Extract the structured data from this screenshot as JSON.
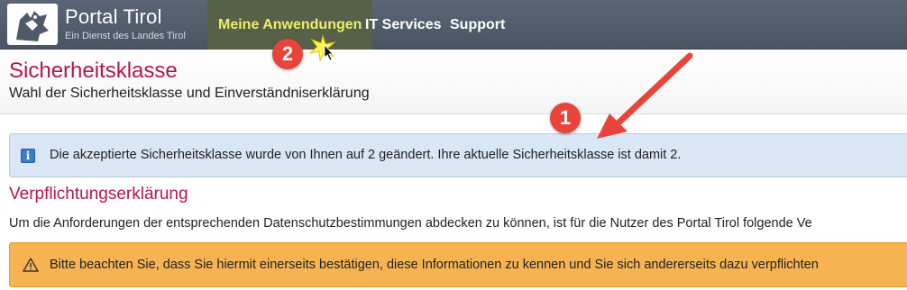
{
  "header": {
    "logo": {
      "title": "Portal Tirol",
      "subtitle": "Ein Dienst des Landes Tirol",
      "icon": "tirol-eagle-logo-icon"
    },
    "nav": [
      {
        "label": "Meine Anwendungen",
        "active": true
      },
      {
        "label": "IT Services",
        "active": false
      },
      {
        "label": "Support",
        "active": false
      }
    ],
    "colors": {
      "bar": "#4f5a68",
      "active_bg": "#566148",
      "active_text": "#e8f06a"
    }
  },
  "page": {
    "title": "Sicherheitsklasse",
    "subtitle": "Wahl der Sicherheitsklasse und Einverständniserklärung",
    "title_color": "#b5164a"
  },
  "info_alert": {
    "icon": "info-icon",
    "text": "Die akzeptierte Sicherheitsklasse wurde von Ihnen auf 2 geändert. Ihre aktuelle Sicherheitsklasse ist damit 2.",
    "color": "#d9e6f6"
  },
  "section": {
    "title": "Verpflichtungserklärung",
    "paragraph": "Um die Anforderungen der entsprechenden Datenschutzbestimmungen abdecken zu können, ist für die Nutzer des Portal Tirol folgende Ve"
  },
  "warning_alert": {
    "icon": "warning-icon",
    "text": "Bitte beachten Sie, dass Sie hiermit einerseits bestätigen, diese Informationen zu kennen und Sie sich andererseits dazu verpflichten",
    "color": "#f7b351"
  },
  "annotations": {
    "badge_1": "1",
    "badge_2": "2",
    "badge_color": "#e8443a"
  }
}
